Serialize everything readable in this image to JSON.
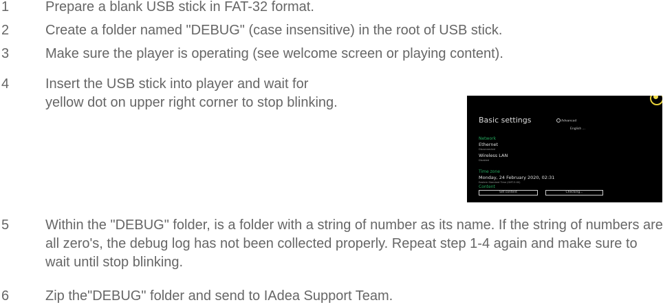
{
  "steps": [
    {
      "number": "1",
      "text": "Prepare a blank USB stick in FAT-32 format."
    },
    {
      "number": "2",
      "text": "Create a folder named \"DEBUG\" (case insensitive) in the root of USB stick."
    },
    {
      "number": "3",
      "text": "Make sure the player is operating (see welcome screen or playing content)."
    },
    {
      "number": "4",
      "text": "Insert the USB stick into player and wait for yellow dot on upper right corner to stop blinking."
    },
    {
      "number": "5",
      "text": "Within the \"DEBUG\" folder, is a folder with a string of number as its name. If the string of numbers are all zero's, the debug log has not been collected properly. Repeat step 1-4 again and make sure to wait until stop blinking."
    },
    {
      "number": "6",
      "text": "Zip the\"DEBUG\" folder and send to IAdea Support Team."
    }
  ],
  "player_screen": {
    "title": "Basic settings",
    "advanced_label": "Advanced",
    "language": "English ...",
    "network_heading": "Network",
    "ethernet_label": "Ethernet",
    "ethernet_status": "Disconnected",
    "wireless_label": "Wireless LAN",
    "wireless_status": "Disabled",
    "timezone_heading": "Time zone",
    "datetime": "Monday, 24 February 2020, 02:31",
    "timezone_value": "Eastern Standard Time (GMT-5:00)",
    "content_heading": "Content",
    "set_content_button": "Set content",
    "checking_button": "Checking...",
    "status_dot_color": "#f1dd4d",
    "accent_green": "#25a85e"
  }
}
